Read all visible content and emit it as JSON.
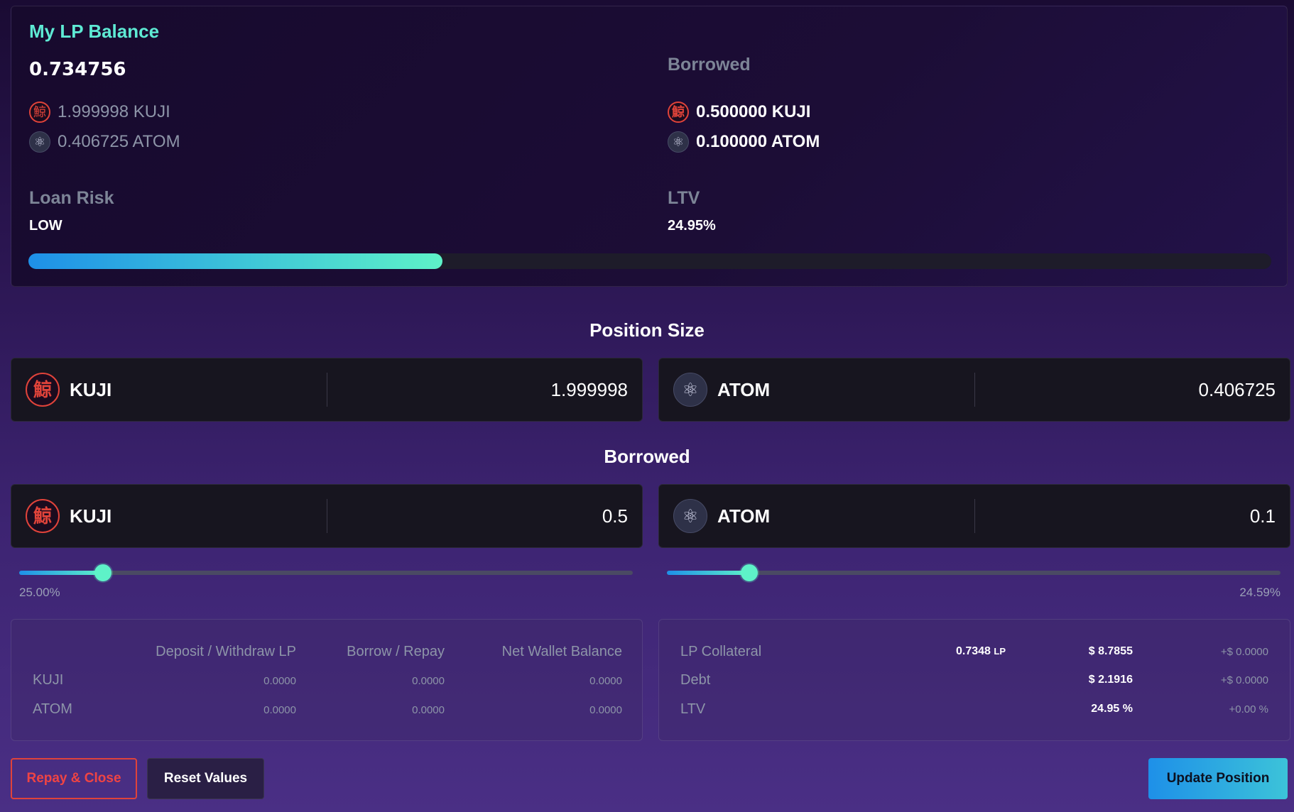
{
  "lp_balance": {
    "title": "My LP Balance",
    "amount": "0.734756",
    "tokens": [
      {
        "icon": "kuji-icon",
        "text": "1.999998 KUJI"
      },
      {
        "icon": "atom-icon",
        "text": "0.406725 ATOM"
      }
    ]
  },
  "borrowed_summary": {
    "title": "Borrowed",
    "tokens": [
      {
        "icon": "kuji-icon",
        "text": "0.500000 KUJI"
      },
      {
        "icon": "atom-icon",
        "text": "0.100000 ATOM"
      }
    ]
  },
  "loan_risk": {
    "label": "Loan Risk",
    "value": "LOW",
    "progress_fraction": 0.333
  },
  "ltv": {
    "label": "LTV",
    "value": "24.95%"
  },
  "position_size": {
    "heading": "Position Size",
    "inputs": [
      {
        "token": "KUJI",
        "value": "1.999998"
      },
      {
        "token": "ATOM",
        "value": "0.406725"
      }
    ]
  },
  "borrowed": {
    "heading": "Borrowed",
    "inputs": [
      {
        "token": "KUJI",
        "value": "0.5"
      },
      {
        "token": "ATOM",
        "value": "0.1"
      }
    ],
    "sliders": [
      {
        "label": "25.00%",
        "fraction": 0.136
      },
      {
        "label": "24.59%",
        "fraction": 0.134
      }
    ]
  },
  "change_table": {
    "headers": [
      "Deposit / Withdraw LP",
      "Borrow / Repay",
      "Net Wallet Balance"
    ],
    "rows": [
      {
        "label": "KUJI",
        "values": [
          "0.0000",
          "0.0000",
          "0.0000"
        ]
      },
      {
        "label": "ATOM",
        "values": [
          "0.0000",
          "0.0000",
          "0.0000"
        ]
      }
    ]
  },
  "stats": {
    "lp_collateral": {
      "label": "LP Collateral",
      "amount": "0.7348",
      "unit": "LP",
      "usd": "$ 8.7855",
      "delta": "+$ 0.0000"
    },
    "debt": {
      "label": "Debt",
      "usd": "$ 2.1916",
      "delta": "+$ 0.0000"
    },
    "ltv": {
      "label": "LTV",
      "value": "24.95 %",
      "delta": "+0.00 %"
    }
  },
  "buttons": {
    "repay_close": "Repay & Close",
    "reset": "Reset Values",
    "update": "Update Position"
  },
  "colors": {
    "accent": "#5ef2c8",
    "danger": "#ef4444",
    "kuji": "#e0433a"
  }
}
